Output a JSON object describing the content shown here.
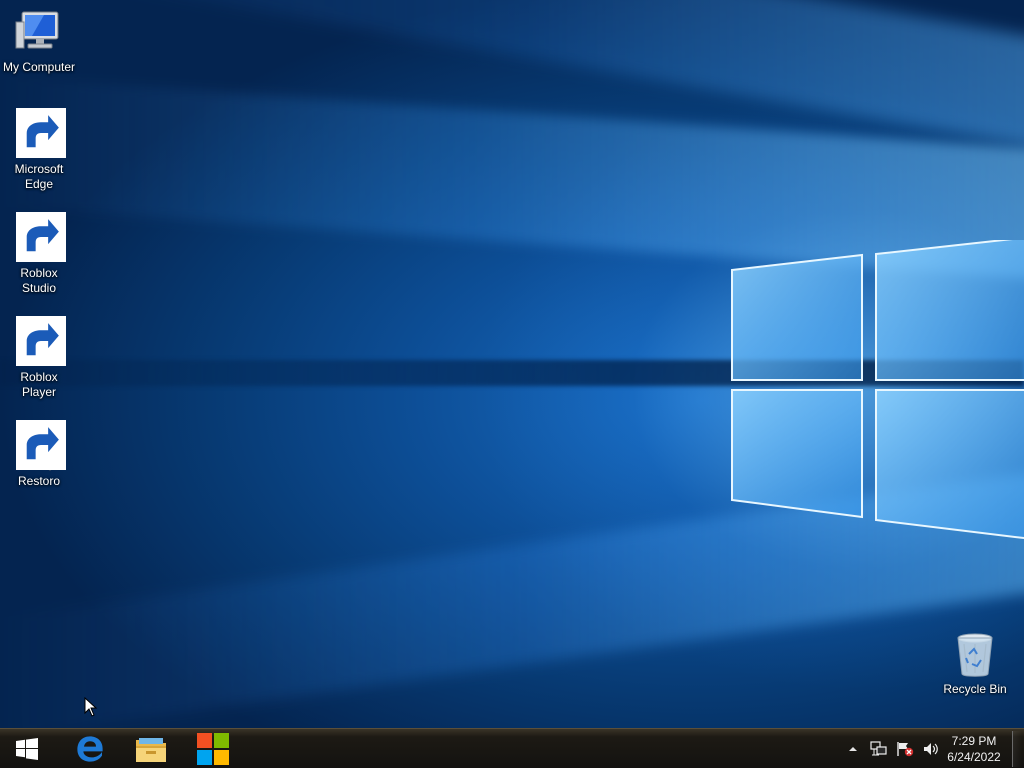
{
  "desktop": {
    "icons": [
      {
        "label": "My Computer",
        "icon": "computer-icon",
        "shortcut": false
      },
      {
        "label": "Microsoft Edge",
        "icon": "edge-icon",
        "shortcut": true
      },
      {
        "label": "Roblox Studio",
        "icon": "roblox-studio-icon",
        "shortcut": true
      },
      {
        "label": "Roblox Player",
        "icon": "roblox-player-icon",
        "shortcut": true
      },
      {
        "label": "Restoro",
        "icon": "restoro-icon",
        "shortcut": true
      }
    ],
    "recycle_bin": {
      "label": "Recycle Bin",
      "icon": "recycle-bin-icon"
    }
  },
  "taskbar": {
    "start": "windows-logo-icon",
    "pinned": [
      "edge-icon",
      "file-explorer-icon",
      "store-icon"
    ],
    "tray": [
      "chevron-up-icon",
      "network-icon",
      "action-center-flag-icon",
      "volume-icon"
    ],
    "clock": {
      "time": "7:29 PM",
      "date": "6/24/2022"
    }
  },
  "colors": {
    "wallpaper": "#0d4f98",
    "taskbar": "#1d1a14",
    "edge_blue": "#1e7ad6"
  }
}
